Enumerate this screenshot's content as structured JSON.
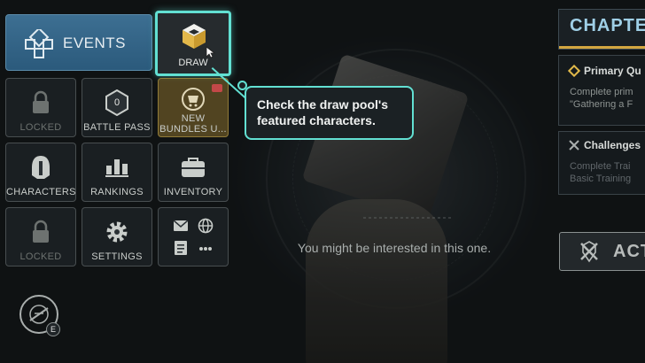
{
  "menu": {
    "events_label": "EVENTS",
    "draw_label": "DRAW",
    "locked_1_label": "LOCKED",
    "battle_pass_label": "BATTLE PASS",
    "battle_pass_level": "0",
    "bundles_label": "NEW BUNDLES U...",
    "characters_label": "CHARACTERS",
    "rankings_label": "RANKINGS",
    "inventory_label": "INVENTORY",
    "locked_2_label": "LOCKED",
    "settings_label": "SETTINGS"
  },
  "tooltip": {
    "text": "Check the draw pool's featured characters."
  },
  "center": {
    "message": "You might be interested in this one."
  },
  "right_panel": {
    "chapter_label": "CHAPTE",
    "primary_quest_title": "Primary Qu",
    "primary_quest_line1": "Complete prim",
    "primary_quest_line2": "\"Gathering a F",
    "challenges_title": "Challenges",
    "challenges_line1": "Complete Trai",
    "challenges_line2": "Basic Training",
    "action_label": "ACT"
  },
  "emblem": {
    "key_hint": "E"
  },
  "colors": {
    "highlight": "#62e0d2",
    "events_blue": "#2b5a7c",
    "chapter_gold": "#d3a640",
    "notification_red": "#c34848"
  },
  "icons": [
    "events-icon",
    "draw-box-icon",
    "lock-icon",
    "battle-pass-icon",
    "bundles-icon",
    "characters-helmet-icon",
    "rankings-icon",
    "inventory-icon",
    "gear-icon",
    "mail-icon",
    "globe-icon",
    "notes-icon",
    "more-icon",
    "diamond-quest-icon",
    "challenges-icon",
    "act-emblem-icon",
    "faction-emblem-icon"
  ]
}
